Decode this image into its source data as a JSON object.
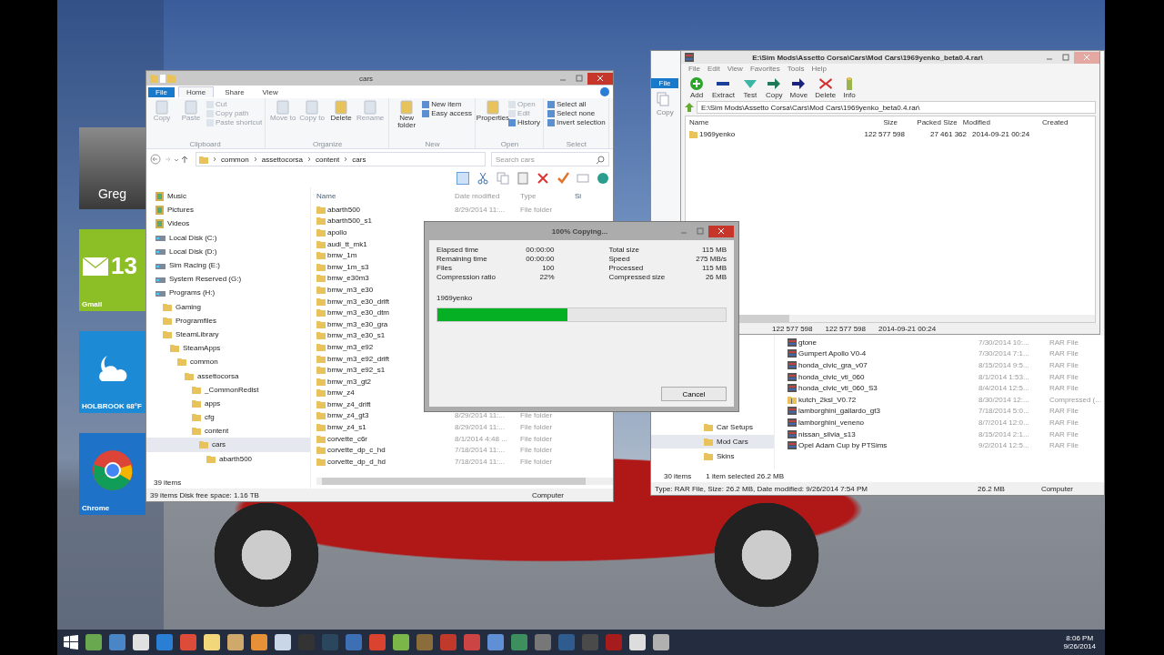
{
  "tiles": [
    {
      "kind": "photo",
      "label": "Greg"
    },
    {
      "kind": "mail",
      "label": "13",
      "caption": "Gmail"
    },
    {
      "kind": "weather",
      "caption": "HOLBROOK 68°F"
    },
    {
      "kind": "browser",
      "caption": "Chrome"
    }
  ],
  "explorer": {
    "title": "cars",
    "tabs": [
      {
        "label": "File",
        "selected": false,
        "kind": "file"
      },
      {
        "label": "Home",
        "selected": true,
        "kind": "tab"
      },
      {
        "label": "Share",
        "selected": false,
        "kind": "tab"
      },
      {
        "label": "View",
        "selected": false,
        "kind": "tab"
      }
    ],
    "ribbon_groups": [
      {
        "name": "Clipboard",
        "items": [
          {
            "label": "Copy",
            "kind": "large",
            "disabled": true
          },
          {
            "label": "Paste",
            "kind": "large",
            "disabled": true
          },
          {
            "label": "Cut",
            "kind": "small",
            "disabled": true
          },
          {
            "label": "Copy path",
            "kind": "small",
            "disabled": true
          },
          {
            "label": "Paste shortcut",
            "kind": "small",
            "disabled": true
          }
        ]
      },
      {
        "name": "Organize",
        "items": [
          {
            "label": "Move to",
            "kind": "large",
            "disabled": true
          },
          {
            "label": "Copy to",
            "kind": "large",
            "disabled": true
          },
          {
            "label": "Delete",
            "kind": "large",
            "disabled": false
          },
          {
            "label": "Rename",
            "kind": "large",
            "disabled": true
          }
        ]
      },
      {
        "name": "New",
        "items": [
          {
            "label": "New folder",
            "kind": "large",
            "disabled": false
          },
          {
            "label": "New item",
            "kind": "small",
            "disabled": false
          },
          {
            "label": "Easy access",
            "kind": "small",
            "disabled": false
          }
        ]
      },
      {
        "name": "Open",
        "items": [
          {
            "label": "Properties",
            "kind": "large",
            "disabled": false
          },
          {
            "label": "Open",
            "kind": "small",
            "disabled": true
          },
          {
            "label": "Edit",
            "kind": "small",
            "disabled": true
          },
          {
            "label": "History",
            "kind": "small",
            "disabled": false
          }
        ]
      },
      {
        "name": "Select",
        "items": [
          {
            "label": "Select all",
            "kind": "small",
            "disabled": false
          },
          {
            "label": "Select none",
            "kind": "small",
            "disabled": false
          },
          {
            "label": "Invert selection",
            "kind": "small",
            "disabled": false
          }
        ]
      }
    ],
    "address": [
      "common",
      "assettocorsa",
      "content",
      "cars"
    ],
    "search": {
      "placeholder": "Search cars"
    },
    "nav": [
      {
        "label": "Music",
        "kind": "library",
        "selected": false
      },
      {
        "label": "Pictures",
        "kind": "library",
        "selected": false
      },
      {
        "label": "Videos",
        "kind": "library",
        "selected": false
      },
      {
        "label": "Local Disk (C:)",
        "kind": "drive",
        "selected": false
      },
      {
        "label": "Local Disk (D:)",
        "kind": "drive",
        "selected": false
      },
      {
        "label": "Sim Racing (E:)",
        "kind": "drive",
        "selected": false
      },
      {
        "label": "System Reserved (G:)",
        "kind": "drive",
        "selected": false
      },
      {
        "label": "Programs (H:)",
        "kind": "drive",
        "selected": false,
        "children": [
          {
            "label": "Gaming",
            "kind": "folder",
            "selected": false
          },
          {
            "label": "Programfiles",
            "kind": "folder",
            "selected": false
          },
          {
            "label": "SteamLibrary",
            "kind": "folder",
            "selected": false,
            "children": [
              {
                "label": "SteamApps",
                "kind": "folder",
                "selected": false,
                "children": [
                  {
                    "label": "common",
                    "kind": "folder",
                    "selected": false,
                    "children": [
                      {
                        "label": "assettocorsa",
                        "kind": "folder",
                        "selected": false,
                        "children": [
                          {
                            "label": "_CommonRedist",
                            "kind": "folder",
                            "selected": false
                          },
                          {
                            "label": "apps",
                            "kind": "folder",
                            "selected": false
                          },
                          {
                            "label": "cfg",
                            "kind": "folder",
                            "selected": false
                          },
                          {
                            "label": "content",
                            "kind": "folder",
                            "selected": false,
                            "children": [
                              {
                                "label": "cars",
                                "kind": "folder",
                                "selected": true,
                                "children": [
                                  {
                                    "label": "abarth500",
                                    "kind": "folder",
                                    "selected": false
                                  }
                                ]
                              }
                            ]
                          }
                        ]
                      }
                    ]
                  }
                ]
              }
            ]
          }
        ]
      }
    ],
    "columns": [
      "Name",
      "Date modified",
      "Type",
      "Si"
    ],
    "rows": [
      {
        "name": "abarth500",
        "date": "8/29/2014 11:...",
        "type": "File folder"
      },
      {
        "name": "abarth500_s1"
      },
      {
        "name": "apollo"
      },
      {
        "name": "audi_tt_mk1"
      },
      {
        "name": "bmw_1m"
      },
      {
        "name": "bmw_1m_s3"
      },
      {
        "name": "bmw_e30m3"
      },
      {
        "name": "bmw_m3_e30"
      },
      {
        "name": "bmw_m3_e30_drift"
      },
      {
        "name": "bmw_m3_e30_dtm"
      },
      {
        "name": "bmw_m3_e30_gra"
      },
      {
        "name": "bmw_m3_e30_s1"
      },
      {
        "name": "bmw_m3_e92"
      },
      {
        "name": "bmw_m3_e92_drift"
      },
      {
        "name": "bmw_m3_e92_s1"
      },
      {
        "name": "bmw_m3_gt2"
      },
      {
        "name": "bmw_z4"
      },
      {
        "name": "bmw_z4_drift"
      },
      {
        "name": "bmw_z4_gt3",
        "date": "8/29/2014 11:...",
        "type": "File folder"
      },
      {
        "name": "bmw_z4_s1",
        "date": "8/29/2014 11:...",
        "type": "File folder"
      },
      {
        "name": "corvette_c6r",
        "date": "8/1/2014 4:48 ...",
        "type": "File folder"
      },
      {
        "name": "corvette_dp_c_hd",
        "date": "7/18/2014 11:...",
        "type": "File folder"
      },
      {
        "name": "corvette_dp_d_hd",
        "date": "7/18/2014 11:...",
        "type": "File folder"
      }
    ],
    "item_count": "39 items",
    "status": "39 items  Disk free space: 1.16 TB",
    "location": "Computer"
  },
  "back_explorer": {
    "file_tab": "File",
    "ribbon_item": "Copy",
    "nav": [
      {
        "label": "Car Setups",
        "selected": false
      },
      {
        "label": "Mod Cars",
        "selected": true
      },
      {
        "label": "Skins",
        "selected": false
      }
    ],
    "rows": [
      {
        "name": "gtone",
        "date": "7/30/2014 10:...",
        "type": "RAR File",
        "kind": "rar"
      },
      {
        "name": "Gumpert Apollo V0-4",
        "date": "7/30/2014 7:1...",
        "type": "RAR File",
        "kind": "rar"
      },
      {
        "name": "honda_civic_gra_v07",
        "date": "8/15/2014 9:5...",
        "type": "RAR File",
        "kind": "rar"
      },
      {
        "name": "honda_civic_vti_060",
        "date": "8/1/2014 1:53...",
        "type": "RAR File",
        "kind": "rar"
      },
      {
        "name": "honda_civic_vti_060_S3",
        "date": "8/4/2014 12:5...",
        "type": "RAR File",
        "kind": "rar"
      },
      {
        "name": "kutch_2ksl_V0.72",
        "date": "8/30/2014 12:...",
        "type": "Compressed (...",
        "kind": "zip"
      },
      {
        "name": "lamborghini_gallardo_gt3",
        "date": "7/18/2014 5:0...",
        "type": "RAR File",
        "kind": "rar"
      },
      {
        "name": "lamborghini_veneno",
        "date": "8/7/2014 12:0...",
        "type": "RAR File",
        "kind": "rar"
      },
      {
        "name": "nissan_silvia_s13",
        "date": "8/15/2014 2:1...",
        "type": "RAR File",
        "kind": "rar"
      },
      {
        "name": "Opel Adam Cup by PTSims",
        "date": "9/2/2014 12:5...",
        "type": "RAR File",
        "kind": "rar"
      }
    ],
    "count": "30 items",
    "selection": "1 item selected  26.2 MB",
    "details": "Type: RAR File, Size: 26.2 MB, Date modified: 9/26/2014 7:54 PM",
    "size": "26.2 MB",
    "location": "Computer"
  },
  "winrar": {
    "title": "E:\\Sim Mods\\Assetto Corsa\\Cars\\Mod Cars\\1969yenko_beta0.4.rar\\",
    "menu": [
      "File",
      "Edit",
      "View",
      "Favorites",
      "Tools",
      "Help"
    ],
    "tools": [
      {
        "label": "Add",
        "kind": "add"
      },
      {
        "label": "Extract",
        "kind": "extract"
      },
      {
        "label": "Test",
        "kind": "test"
      },
      {
        "label": "Copy",
        "kind": "copy"
      },
      {
        "label": "Move",
        "kind": "move"
      },
      {
        "label": "Delete",
        "kind": "delete"
      },
      {
        "label": "Info",
        "kind": "info"
      }
    ],
    "path": "E:\\Sim Mods\\Assetto Corsa\\Cars\\Mod Cars\\1969yenko_beta0.4.rar\\",
    "columns": [
      "Name",
      "Size",
      "Packed Size",
      "Modified",
      "Created"
    ],
    "rows": [
      {
        "name": "1969yenko",
        "size": "122 577 598",
        "packed": "27 461 362",
        "modified": "2014-09-21 00:24"
      }
    ],
    "status": [
      "122 577 598",
      "122 577 598",
      "2014-09-21 00:24"
    ]
  },
  "dialog": {
    "title": "100% Copying...",
    "stats_left": [
      {
        "label": "Elapsed time",
        "value": "00:00:00"
      },
      {
        "label": "Remaining time",
        "value": "00:00:00"
      },
      {
        "label": "Files",
        "value": "100"
      },
      {
        "label": "Compression ratio",
        "value": "22%"
      }
    ],
    "stats_right": [
      {
        "label": "Total size",
        "value": "115 MB"
      },
      {
        "label": "Speed",
        "value": "275 MB/s"
      },
      {
        "label": "Processed",
        "value": "115 MB"
      },
      {
        "label": "Compressed size",
        "value": "26 MB"
      }
    ],
    "file": "1969yenko",
    "level": 0.45,
    "button": "Cancel"
  },
  "clock": {
    "time": "8:06 PM",
    "date": "9/26/2014"
  }
}
